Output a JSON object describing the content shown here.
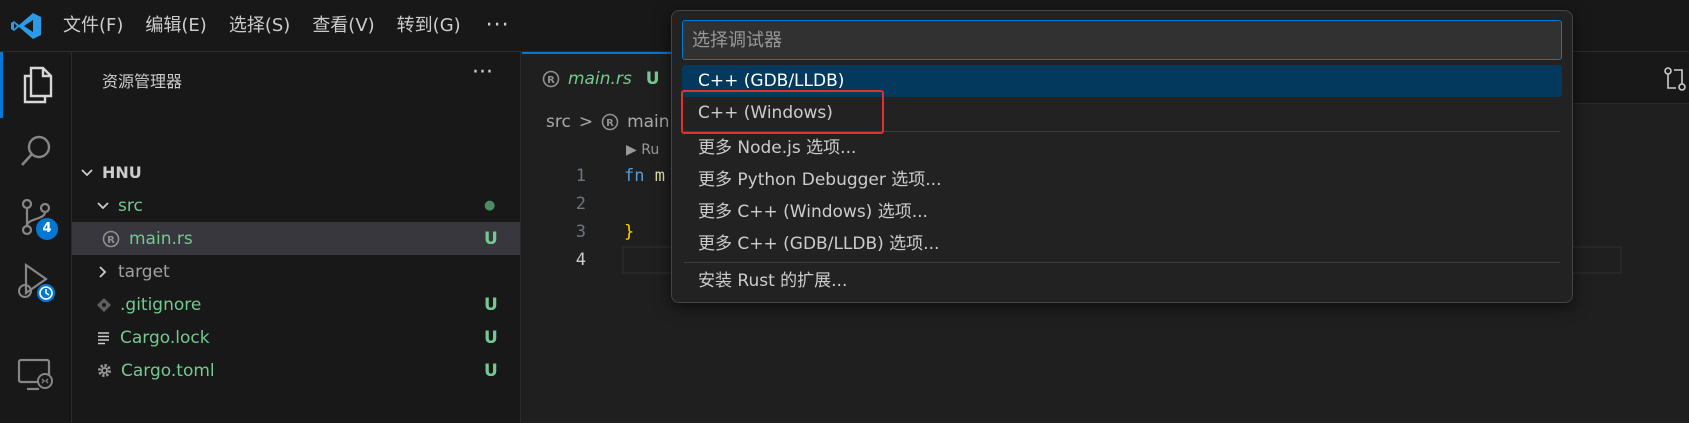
{
  "menu": {
    "items": [
      "文件(F)",
      "编辑(E)",
      "选择(S)",
      "查看(V)",
      "转到(G)"
    ],
    "more": "···"
  },
  "activity": {
    "scm_badge": "4"
  },
  "explorer": {
    "title": "资源管理器",
    "more": "···",
    "items": [
      {
        "label": "HNU",
        "status": ""
      },
      {
        "label": "src",
        "status": "●"
      },
      {
        "label": "main.rs",
        "status": "U"
      },
      {
        "label": "target",
        "status": ""
      },
      {
        "label": ".gitignore",
        "status": "U"
      },
      {
        "label": "Cargo.lock",
        "status": "U"
      },
      {
        "label": "Cargo.toml",
        "status": "U"
      }
    ]
  },
  "editor": {
    "tab": {
      "name": "main.rs",
      "status": "U"
    },
    "breadcrumb": {
      "folder": "src",
      "separator": ">",
      "file": "main"
    },
    "codelens": "▶ Ru",
    "lines": [
      {
        "num": "1",
        "kw": "fn",
        "rest": " m"
      },
      {
        "num": "2",
        "kw": "",
        "rest": ""
      },
      {
        "num": "3",
        "kw": "",
        "rest": "}"
      },
      {
        "num": "4",
        "kw": "",
        "rest": ""
      }
    ]
  },
  "quickpick": {
    "placeholder": "选择调试器",
    "items": [
      "C++ (GDB/LLDB)",
      "C++ (Windows)",
      "更多 Node.js 选项...",
      "更多 Python Debugger 选项...",
      "更多 C++ (Windows) 选项...",
      "更多 C++ (GDB/LLDB) 选项...",
      "安装 Rust 的扩展..."
    ]
  },
  "colors": {
    "accent": "#0078d4",
    "untracked": "#73c991",
    "highlight": "#e03030",
    "selection": "#04395e"
  }
}
